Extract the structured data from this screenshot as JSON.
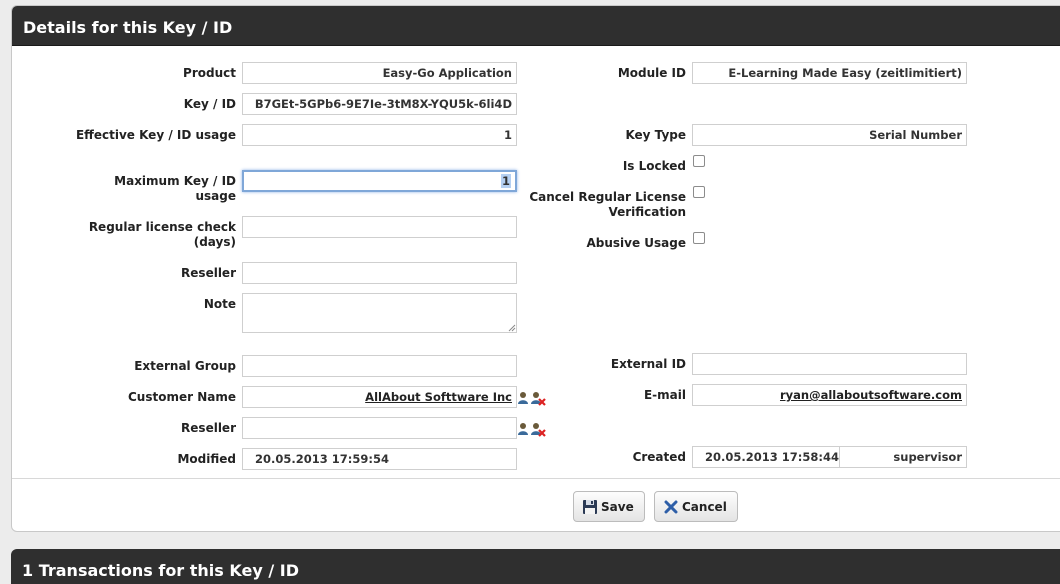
{
  "details_panel": {
    "title": "Details for this Key / ID"
  },
  "left_fields": {
    "product": {
      "label": "Product",
      "value": "Easy-Go Application"
    },
    "key_id": {
      "label": "Key / ID",
      "value": "B7GEt-5GPb6-9E7Ie-3tM8X-YQU5k-6li4D"
    },
    "effective_usage": {
      "label": "Effective Key / ID usage",
      "value": "1"
    },
    "maximum_usage": {
      "label": "Maximum Key / ID usage",
      "value": "1"
    },
    "regular_check": {
      "label": "Regular license check (days)",
      "value": ""
    },
    "reseller": {
      "label": "Reseller",
      "value": ""
    },
    "note": {
      "label": "Note",
      "value": ""
    },
    "external_group": {
      "label": "External Group",
      "value": ""
    },
    "customer_name": {
      "label": "Customer Name",
      "value": "AllAbout Softtware Inc"
    },
    "reseller2": {
      "label": "Reseller",
      "value": ""
    },
    "modified": {
      "label": "Modified",
      "value": "20.05.2013 17:59:54"
    }
  },
  "right_fields": {
    "module_id": {
      "label": "Module ID",
      "value": "E-Learning Made Easy (zeitlimitiert)"
    },
    "key_type": {
      "label": "Key Type",
      "value": "Serial Number"
    },
    "is_locked": {
      "label": "Is Locked",
      "checked": false
    },
    "cancel_verification": {
      "label": "Cancel Regular License Verification",
      "checked": false
    },
    "abusive_usage": {
      "label": "Abusive Usage",
      "checked": false
    },
    "external_id": {
      "label": "External ID",
      "value": ""
    },
    "email": {
      "label": "E-mail",
      "value": "ryan@allaboutsoftware.com"
    },
    "created": {
      "label": "Created",
      "value": "20.05.2013 17:58:44",
      "by": "supervisor"
    }
  },
  "buttons": {
    "save": "Save",
    "cancel": "Cancel"
  },
  "transactions_panel": {
    "title": "1 Transactions for this Key / ID"
  },
  "colors": {
    "header_bg": "#2f2f2f",
    "focus_border": "#7fa7d8"
  }
}
